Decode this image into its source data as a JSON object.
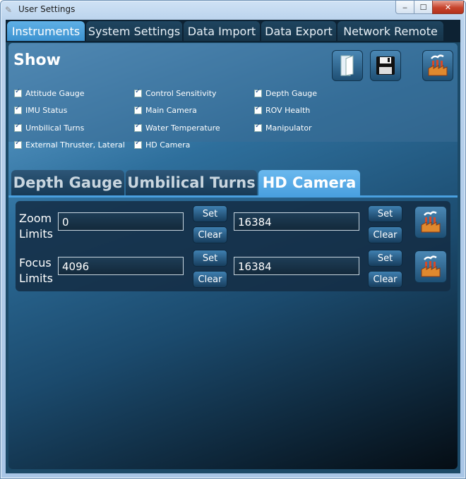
{
  "window": {
    "title": "User Settings",
    "minimize": "‒",
    "maximize": "☐",
    "close": "✕"
  },
  "main_tabs": [
    {
      "label": "Instruments"
    },
    {
      "label": "System Settings"
    },
    {
      "label": "Data Import"
    },
    {
      "label": "Data Export"
    },
    {
      "label": "Network Remote"
    }
  ],
  "show": {
    "title": "Show",
    "toolbar": {
      "open_icon": "document-icon",
      "save_icon": "floppy-disk-icon",
      "defaults_icon": "factory-icon"
    },
    "checkboxes": [
      {
        "label": "Attitude Gauge",
        "checked": true
      },
      {
        "label": "IMU Status",
        "checked": true
      },
      {
        "label": "Umbilical Turns",
        "checked": true
      },
      {
        "label": "External Thruster, Lateral",
        "checked": true
      },
      {
        "label": "Control Sensitivity",
        "checked": true
      },
      {
        "label": "Main Camera",
        "checked": true
      },
      {
        "label": "Water Temperature",
        "checked": true
      },
      {
        "label": "HD Camera",
        "checked": true
      },
      {
        "label": "Depth Gauge",
        "checked": true
      },
      {
        "label": "ROV Health",
        "checked": true
      },
      {
        "label": "Manipulator",
        "checked": true
      }
    ]
  },
  "sub_tabs": [
    {
      "label": "Depth Gauge"
    },
    {
      "label": "Umbilical Turns"
    },
    {
      "label": "HD Camera"
    }
  ],
  "hd_camera": {
    "zoom": {
      "label": "Zoom Limits",
      "min": "0",
      "max": "16384"
    },
    "focus": {
      "label": "Focus Limits",
      "min": "4096",
      "max": "16384"
    },
    "set_label": "Set",
    "clear_label": "Clear"
  }
}
